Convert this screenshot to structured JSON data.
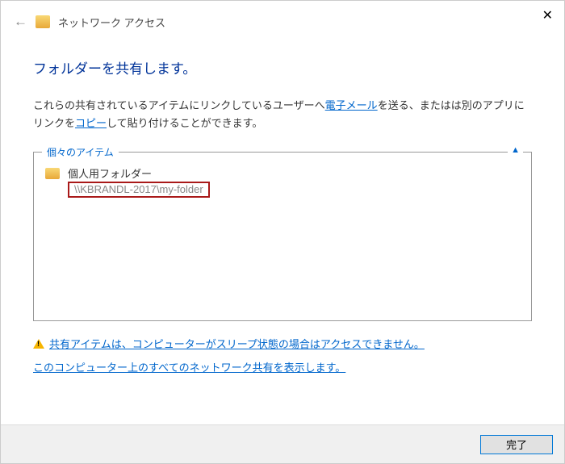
{
  "header": {
    "title": "ネットワーク アクセス"
  },
  "main": {
    "title": "フォルダーを共有します。",
    "desc_part1": "これらの共有されているアイテムにリンクしているユーザーへ",
    "email_link": "電子メール",
    "desc_part2": "を送る、またはは別のアプリにリンクを",
    "copy_link": "コピー",
    "desc_part3": "して貼り付けることができます。"
  },
  "items_box": {
    "legend": "個々のアイテム",
    "item_name": "個人用フォルダー",
    "item_path": "\\\\KBRANDL-2017\\my-folder"
  },
  "notices": {
    "sleep_warning": "共有アイテムは、コンピューターがスリープ状態の場合はアクセスできません。",
    "show_all": "このコンピューター上のすべてのネットワーク共有を表示します。"
  },
  "footer": {
    "done": "完了"
  }
}
